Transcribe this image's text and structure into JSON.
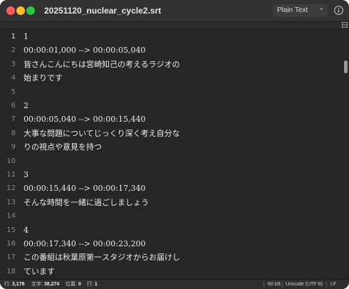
{
  "window": {
    "title": "20251120_nuclear_cycle2.srt",
    "syntax_mode": "Plain Text"
  },
  "editor": {
    "current_line": 1,
    "lines": [
      {
        "num": "1",
        "text": "1"
      },
      {
        "num": "2",
        "text": "00:00:01,000 --> 00:00:05,040"
      },
      {
        "num": "3",
        "text": "皆さんこんにちは宮崎知己の考えるラジオの"
      },
      {
        "num": "4",
        "text": "始まりです"
      },
      {
        "num": "5",
        "text": ""
      },
      {
        "num": "6",
        "text": "2"
      },
      {
        "num": "7",
        "text": "00:00:05,040 --> 00:00:15,440"
      },
      {
        "num": "8",
        "text": "大事な問題についてじっくり深く考え自分な"
      },
      {
        "num": "9",
        "text": "りの視点や意見を持つ"
      },
      {
        "num": "10",
        "text": ""
      },
      {
        "num": "11",
        "text": "3"
      },
      {
        "num": "12",
        "text": "00:00:15,440 --> 00:00:17,340"
      },
      {
        "num": "13",
        "text": "そんな時間を一緒に過ごしましょう"
      },
      {
        "num": "14",
        "text": ""
      },
      {
        "num": "15",
        "text": "4"
      },
      {
        "num": "16",
        "text": "00:00:17,340 --> 00:00:23,200"
      },
      {
        "num": "17",
        "text": "この番組は秋葉原第一スタジオからお届けし"
      },
      {
        "num": "18",
        "text": "ています"
      }
    ]
  },
  "status_bar": {
    "line_label": "行:",
    "line_value": "3,178",
    "chars_label": "文字:",
    "chars_value": "38,274",
    "pos_label": "位置:",
    "pos_value": "0",
    "row_label": "行:",
    "row_value": "1",
    "file_size": "60 kB",
    "encoding": "Unicode (UTF-8)",
    "line_ending": "LF"
  },
  "icons": {
    "info": "info-icon",
    "split": "split-editor-icon",
    "chevron": "up-down-chevron-icon"
  },
  "colors": {
    "close": "#fe5f57",
    "minimize": "#febc2e",
    "maximize": "#28c840",
    "background": "#262626"
  }
}
